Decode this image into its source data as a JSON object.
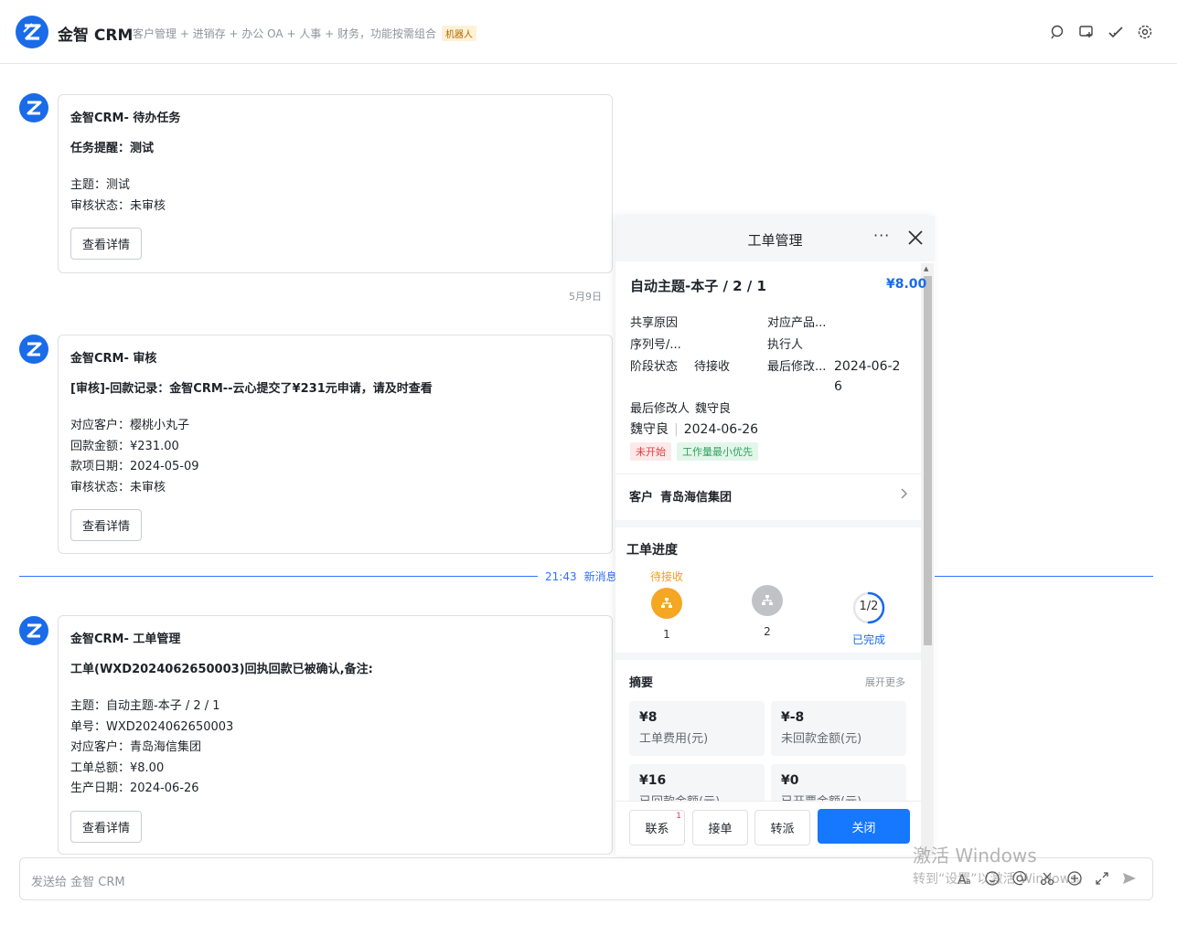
{
  "header": {
    "title": "金智 CRM",
    "subtitle": "客户管理 + 进销存 + 办公 OA + 人事 + 财务，功能按需组合",
    "badge": "机器人"
  },
  "messages": [
    {
      "title": "金智CRM- 待办任务",
      "headline": "任务提醒：测试",
      "lines": [
        "主题：测试",
        "审核状态：未审核"
      ],
      "button": "查看详情"
    },
    {
      "title": "金智CRM- 审核",
      "headline": "[审核]-回款记录：金智CRM--云心提交了¥231元申请，请及时查看",
      "lines": [
        "对应客户：樱桃小丸子",
        "回款金额：¥231.00",
        "款项日期：2024-05-09",
        "审核状态：未审核"
      ],
      "button": "查看详情"
    },
    {
      "title": "金智CRM- 工单管理",
      "headline": "工单(WXD2024062650003)回执回款已被确认,备注:",
      "lines": [
        "主题：自动主题-本子 / 2 / 1",
        "单号：WXD2024062650003",
        "对应客户：青岛海信集团",
        "工单总额：¥8.00",
        "生产日期：2024-06-26"
      ],
      "button": "查看详情"
    }
  ],
  "date_separator": "5月9日",
  "new_message_divider": {
    "time": "21:43",
    "label": "新消息"
  },
  "composer": {
    "placeholder": "发送给 金智 CRM"
  },
  "panel": {
    "title": "工单管理",
    "more": "···",
    "work_order": {
      "title": "自动主题-本子 / 2 / 1",
      "amount": "¥8.00",
      "share_reason_label": "共享原因",
      "product_label": "对应产品...",
      "serial_label": "序列号/...",
      "executor_label": "执行人",
      "stage_label": "阶段状态",
      "stage_value": "待接收",
      "last_modified_label": "最后修改...",
      "last_modified_value_1": "2024-06-2",
      "last_modified_value_2": "6",
      "last_modifier_label": "最后修改人",
      "last_modifier_value": "魏守良",
      "creator": "魏守良",
      "created_date": "2024-06-26",
      "tag_status": "未开始",
      "tag_priority": "工作量最小优先"
    },
    "customer": {
      "label": "客户",
      "value": "青岛海信集团"
    },
    "progress": {
      "title": "工单进度",
      "step1_label": "待接收",
      "step1_num": "1",
      "step2_num": "2",
      "ratio": "1/2",
      "done_label": "已完成",
      "done_fraction": 0.5
    },
    "summary": {
      "title": "摘要",
      "more": "展开更多",
      "items": [
        {
          "value": "¥8",
          "label": "工单费用(元)"
        },
        {
          "value": "¥-8",
          "label": "未回款金额(元)"
        },
        {
          "value": "¥16",
          "label": "已回款金额(元)"
        },
        {
          "value": "¥0",
          "label": "已开票金额(元)"
        }
      ]
    },
    "actions": {
      "contact": "联系",
      "contact_badge": "1",
      "accept": "接单",
      "transfer": "转派",
      "close": "关闭"
    }
  },
  "watermark": {
    "line1": "激活 Windows",
    "line2": "转到“设置”以激活 Windows。"
  },
  "colors": {
    "brand": "#1a6be8",
    "primary_button": "#1677ff",
    "step_active": "#f5a623"
  }
}
